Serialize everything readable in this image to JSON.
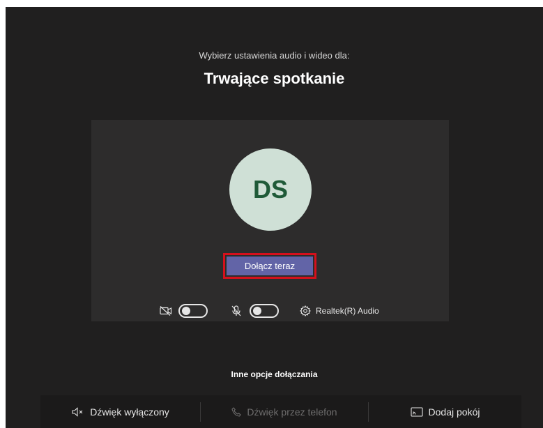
{
  "prejoin": {
    "subtitle": "Wybierz ustawienia audio i wideo dla:",
    "meeting_title": "Trwające spotkanie",
    "avatar_initials": "DS",
    "join_button": "Dołącz teraz",
    "camera_toggle": "off",
    "mic_toggle": "off",
    "audio_device": "Realtek(R) Audio"
  },
  "other_options": {
    "title": "Inne opcje dołączania",
    "audio_off": "Dźwięk wyłączony",
    "phone_audio": "Dźwięk przez telefon",
    "add_room": "Dodaj pokój"
  },
  "colors": {
    "background": "#201f1f",
    "card": "#2d2c2c",
    "accent": "#6264a7",
    "avatar_bg": "#cfe0d6",
    "avatar_text": "#1f5a38",
    "highlight": "#d5101c"
  },
  "icons": {
    "camera": "camera-off-icon",
    "mic": "mic-off-icon",
    "settings": "gear-icon",
    "speaker": "speaker-mute-icon",
    "phone": "phone-icon",
    "room": "cast-icon"
  }
}
